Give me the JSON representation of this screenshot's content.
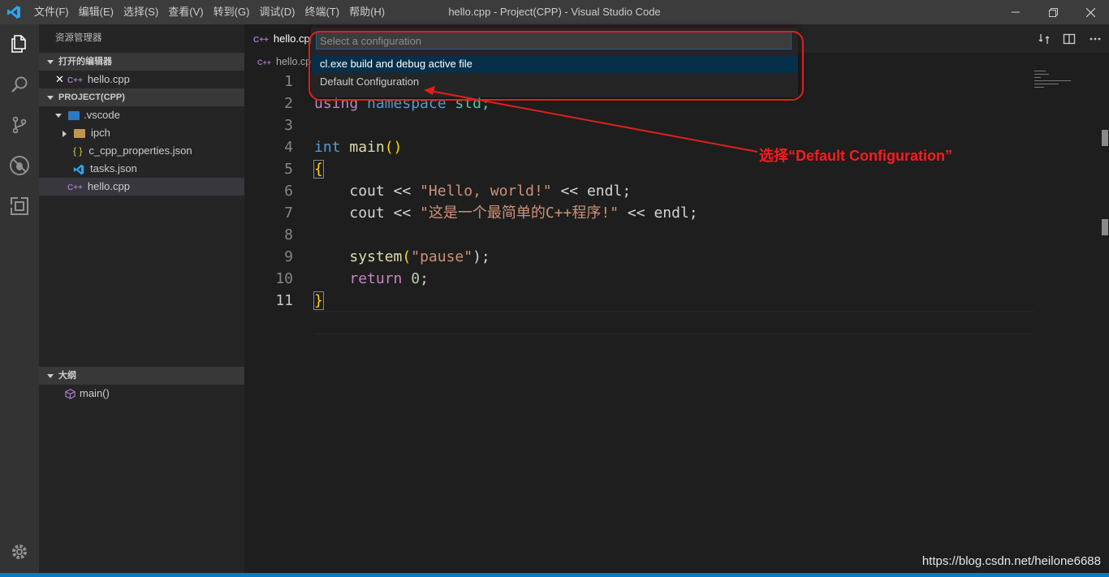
{
  "window": {
    "title": "hello.cpp - Project(CPP) - Visual Studio Code",
    "menu": [
      "文件(F)",
      "编辑(E)",
      "选择(S)",
      "查看(V)",
      "转到(G)",
      "调试(D)",
      "终端(T)",
      "帮助(H)"
    ]
  },
  "sidebar": {
    "title": "资源管理器",
    "open_editors": {
      "header": "打开的编辑器",
      "items": [
        {
          "name": "hello.cpp"
        }
      ]
    },
    "project": {
      "header": "PROJECT(CPP)",
      "items": [
        {
          "name": ".vscode"
        },
        {
          "name": "ipch"
        },
        {
          "name": "c_cpp_properties.json"
        },
        {
          "name": "tasks.json"
        },
        {
          "name": "hello.cpp"
        }
      ]
    },
    "outline": {
      "header": "大纲",
      "items": [
        {
          "name": "main()"
        }
      ]
    }
  },
  "editor": {
    "tab": "hello.cpp",
    "breadcrumb": "hello.cp",
    "line_numbers": [
      "1",
      "2",
      "3",
      "4",
      "5",
      "6",
      "7",
      "8",
      "9",
      "10",
      "11"
    ],
    "code": {
      "l2": {
        "a": "using",
        "b": "namespace",
        "c": "std;"
      },
      "l4": {
        "a": "int",
        "b": "main",
        "c": "()"
      },
      "l5": {
        "a": "{"
      },
      "l6": {
        "a": "cout << ",
        "b": "\"Hello, world!\"",
        "c": " << endl;"
      },
      "l7": {
        "a": "cout << ",
        "b": "\"这是一个最简单的C++程序!\"",
        "c": " << endl;"
      },
      "l9": {
        "a": "system",
        "b": "(",
        "c": "\"pause\"",
        "d": ");"
      },
      "l10": {
        "a": "return",
        "b": "0",
        "c": ";"
      },
      "l11": {
        "a": "}"
      }
    }
  },
  "quick_pick": {
    "placeholder": "Select a configuration",
    "items": [
      "cl.exe build and debug active file",
      "Default Configuration"
    ]
  },
  "annotation": {
    "text": "选择“Default Configuration”",
    "color": "#ff1a1a"
  },
  "watermark": "https://blog.csdn.net/heilone6688",
  "colors": {
    "accent": "#007acc",
    "activity_bar": "#333333",
    "sidebar": "#252526",
    "editor": "#1e1e1e"
  }
}
